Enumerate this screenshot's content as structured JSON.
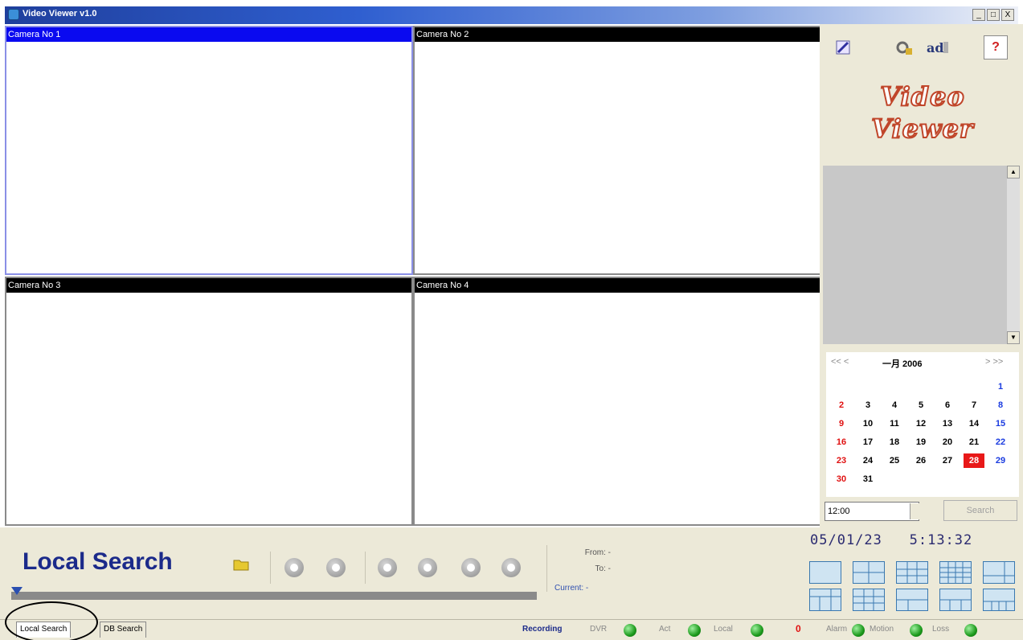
{
  "window": {
    "title": "Video Viewer v1.0",
    "minimize": "_",
    "maximize": "□",
    "close": "X"
  },
  "cameras": [
    {
      "label": "Camera No 1"
    },
    {
      "label": "Camera No 2"
    },
    {
      "label": "Camera No 3"
    },
    {
      "label": "Camera No 4"
    }
  ],
  "toolbar": {
    "icons": [
      "edit-icon",
      "settings-icon",
      "network-icon",
      "help-icon"
    ],
    "help_label": "?"
  },
  "logo": {
    "line1": "Video",
    "line2": "Viewer"
  },
  "calendar": {
    "prev": "<< <",
    "next": "> >>",
    "month_title": "一月 2006",
    "selected_day": 28,
    "weeks": [
      [
        "",
        "",
        "",
        "",
        "",
        "",
        "1"
      ],
      [
        "2",
        "3",
        "4",
        "5",
        "6",
        "7",
        "8"
      ],
      [
        "9",
        "10",
        "11",
        "12",
        "13",
        "14",
        "15"
      ],
      [
        "16",
        "17",
        "18",
        "19",
        "20",
        "21",
        "22"
      ],
      [
        "23",
        "24",
        "25",
        "26",
        "27",
        "28",
        "29"
      ],
      [
        "30",
        "31",
        "",
        "",
        "",
        "",
        ""
      ]
    ]
  },
  "time_input": {
    "value": "12:00"
  },
  "search_button": {
    "label": "Search"
  },
  "playback": {
    "title": "Local Search",
    "from_label": "From: -",
    "to_label": "To: -",
    "current_label": "Current: -"
  },
  "clock": {
    "date": "05/01/23",
    "time": "5:13:32"
  },
  "tabs": [
    {
      "label": "Local Search"
    },
    {
      "label": "DB Search"
    }
  ],
  "status": {
    "recording_label": "Recording",
    "dvr_label": "DVR",
    "act_label": "Act",
    "local_label": "Local",
    "count": "0",
    "alarm_label": "Alarm",
    "motion_label": "Motion",
    "loss_label": "Loss"
  },
  "colors": {
    "active_camera_header": "#0a0af0",
    "calendar_selected": "#e81818",
    "led_green": "#1c9a1c",
    "title_text": "#1b2a8a"
  }
}
